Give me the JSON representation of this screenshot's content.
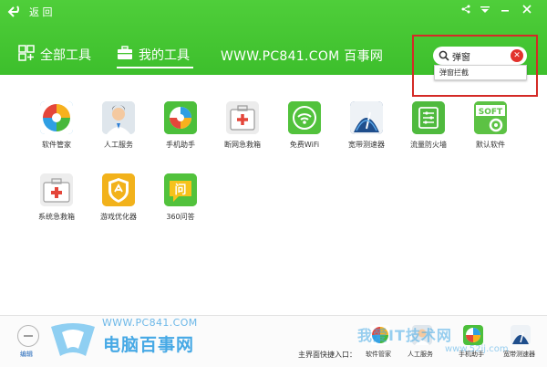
{
  "header": {
    "back_label": "返 回",
    "tabs": [
      {
        "label": "全部工具",
        "active": false
      },
      {
        "label": "我的工具",
        "active": true
      }
    ],
    "site_title": "WWW.PC841.COM 百事网"
  },
  "search": {
    "value": "弹窗",
    "suggestion": "弹窗拦截"
  },
  "tools": [
    {
      "label": "软件管家",
      "icon": "software-manager-icon"
    },
    {
      "label": "人工服务",
      "icon": "customer-service-icon"
    },
    {
      "label": "手机助手",
      "icon": "phone-assistant-icon"
    },
    {
      "label": "断网急救箱",
      "icon": "network-first-aid-icon"
    },
    {
      "label": "免费WiFi",
      "icon": "wifi-icon"
    },
    {
      "label": "宽带测速器",
      "icon": "speed-test-icon"
    },
    {
      "label": "流量防火墙",
      "icon": "firewall-icon"
    },
    {
      "label": "默认软件",
      "icon": "default-software-icon"
    },
    {
      "label": "系统急救箱",
      "icon": "system-first-aid-icon"
    },
    {
      "label": "游戏优化器",
      "icon": "game-optimizer-icon"
    },
    {
      "label": "360问答",
      "icon": "qa-icon"
    }
  ],
  "soft_icon_text": "SOFT",
  "qa_icon_text": "问",
  "bottom": {
    "rect_label": "编辑",
    "brand_url": "WWW.PC841.COM",
    "brand_name": "电脑百事网",
    "entry_label": "主界面快捷入口：",
    "shortcuts": [
      "软件管家",
      "人工服务",
      "手机助手",
      "宽带测速器"
    ],
    "watermark": "我爱IT技术网",
    "watermark_url": "www.52ij.com"
  },
  "colors": {
    "header_green": "#43c52f",
    "highlight_red": "#d42a26",
    "brand_blue": "#47a9e5"
  }
}
